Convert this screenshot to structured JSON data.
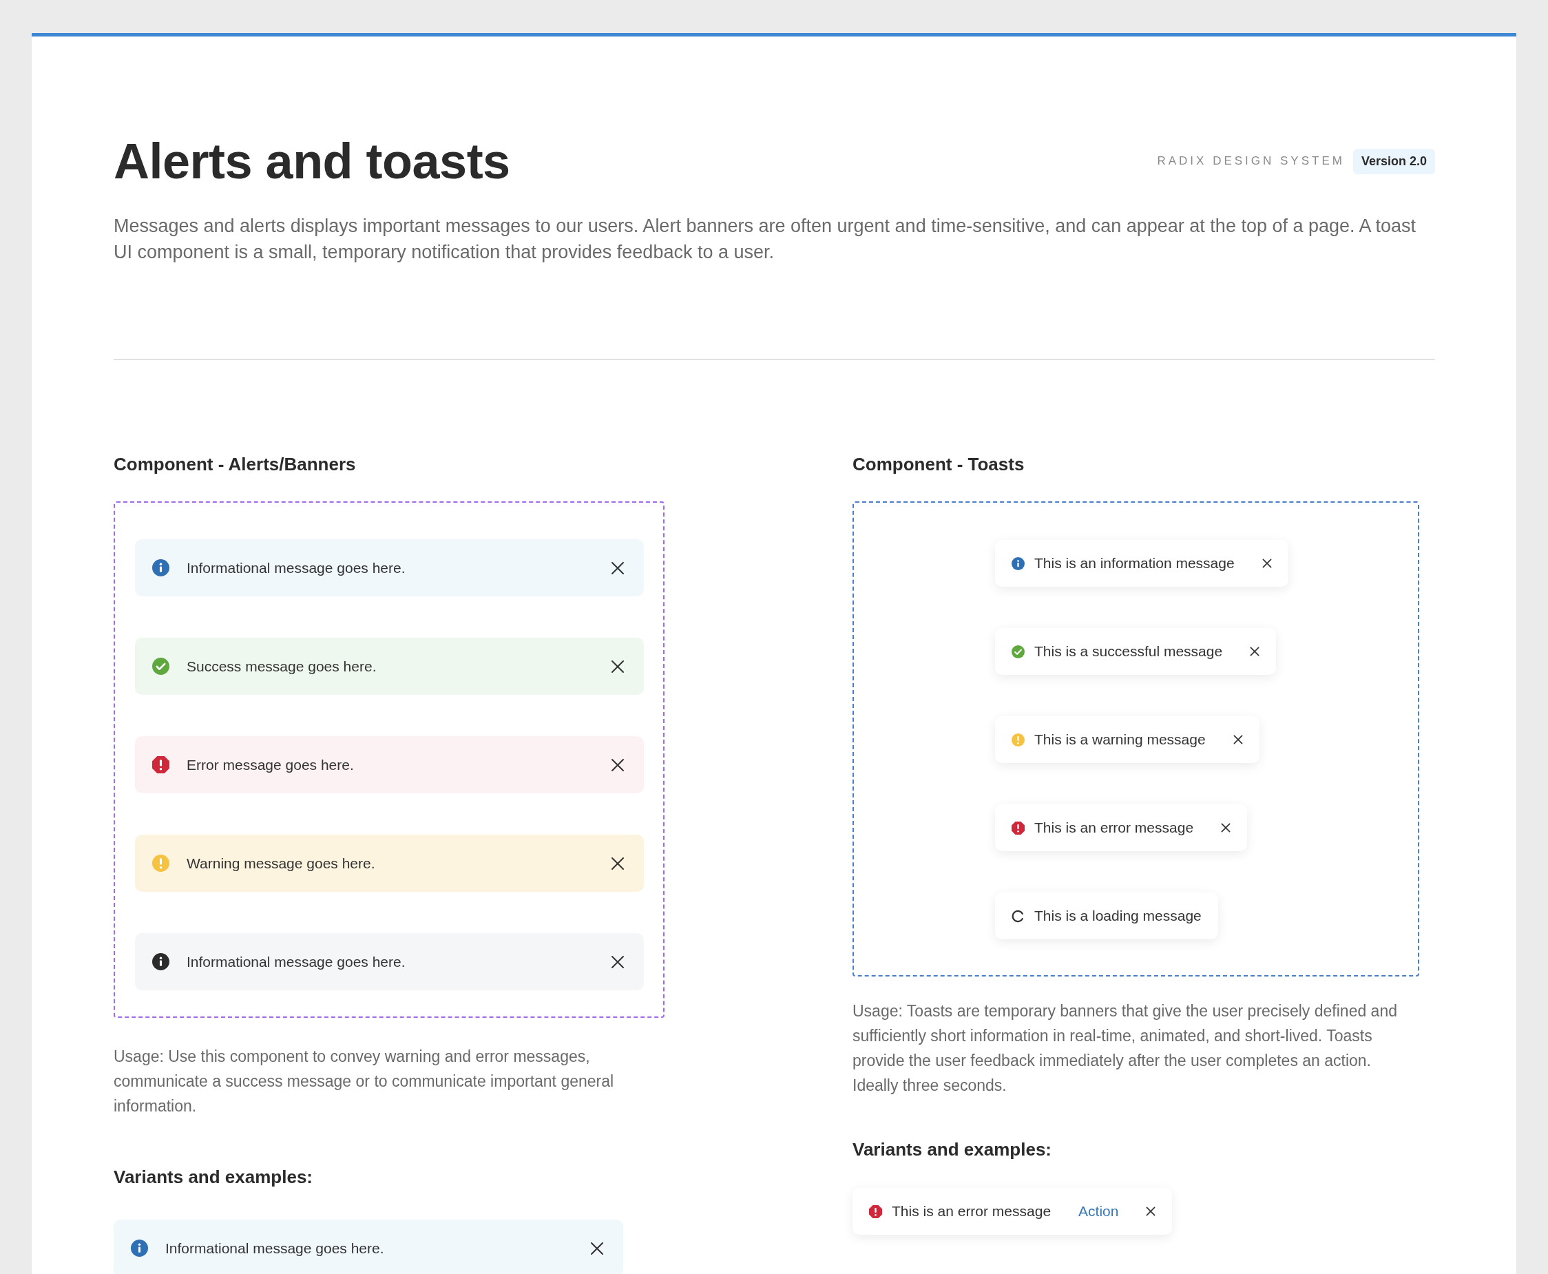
{
  "header": {
    "title": "Alerts and toasts",
    "brand": "RADIX DESIGN SYSTEM",
    "version": "Version 2.0",
    "description": "Messages and alerts displays important messages to our users. Alert banners are often urgent and time-sensitive, and can appear at the top of a page. A toast UI component is a small, temporary notification that provides feedback to a user."
  },
  "alerts_section": {
    "heading": "Component - Alerts/Banners",
    "alerts": [
      {
        "kind": "info",
        "message": "Informational message goes here."
      },
      {
        "kind": "success",
        "message": "Success message goes here."
      },
      {
        "kind": "error",
        "message": "Error message goes here."
      },
      {
        "kind": "warning",
        "message": "Warning message goes here."
      },
      {
        "kind": "neutral",
        "message": "Informational message goes here."
      }
    ],
    "usage": "Usage: Use this component to convey warning and error messages, communicate a success message or to communicate important general information.",
    "variants_heading": "Variants and examples:",
    "variant_alerts": [
      {
        "kind": "info",
        "message": "Informational message goes here."
      }
    ]
  },
  "toasts_section": {
    "heading": "Component - Toasts",
    "toasts": [
      {
        "kind": "info",
        "message": "This is an information message",
        "closable": true
      },
      {
        "kind": "success",
        "message": "This is a successful message",
        "closable": true
      },
      {
        "kind": "warning",
        "message": "This is a warning message",
        "closable": true
      },
      {
        "kind": "error",
        "message": "This is an error message",
        "closable": true
      },
      {
        "kind": "loading",
        "message": "This is a loading message",
        "closable": false
      }
    ],
    "usage": "Usage: Toasts are temporary banners that give the user precisely defined and sufficiently short information in real-time, animated, and short-lived. Toasts provide the user feedback immediately after the user completes an action. Ideally three seconds.",
    "variants_heading": "Variants and examples:",
    "variant_toasts": [
      {
        "kind": "error",
        "message": "This is an error message",
        "action": "Action",
        "closable": true
      }
    ]
  }
}
